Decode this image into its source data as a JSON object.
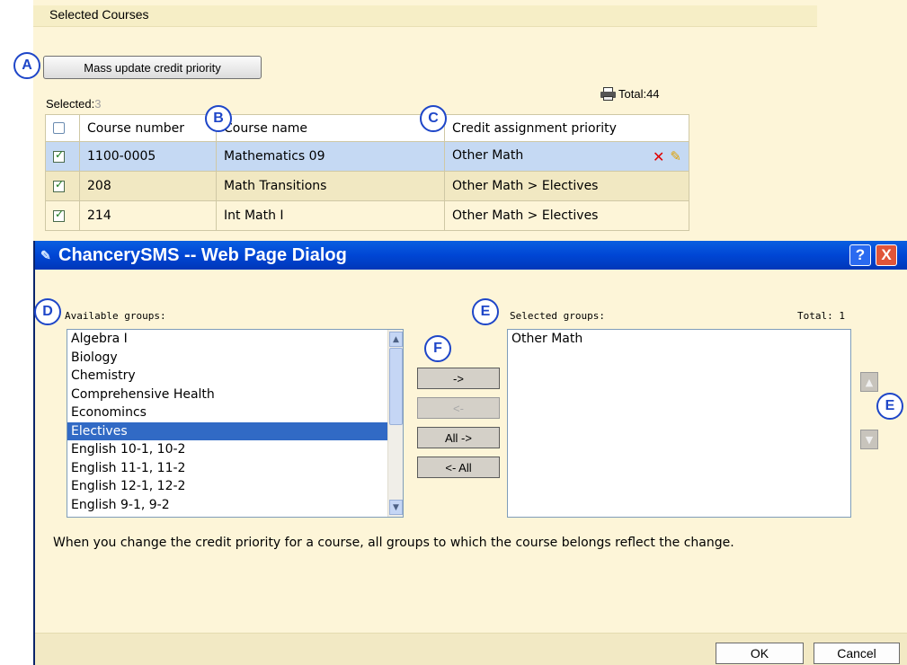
{
  "page": {
    "section_title": "Selected Courses",
    "mass_update_label": "Mass update credit priority",
    "selected_label": "Selected:",
    "selected_count": "3",
    "total_label": "Total:44"
  },
  "table": {
    "headers": [
      "",
      "Course number",
      "Course name",
      "Credit assignment priority"
    ],
    "rows": [
      {
        "checked": true,
        "number": "1100-0005",
        "name": "Mathematics 09",
        "priority": "Other Math"
      },
      {
        "checked": true,
        "number": "208",
        "name": "Math Transitions",
        "priority": "Other Math > Electives"
      },
      {
        "checked": true,
        "number": "214",
        "name": "Int Math I",
        "priority": "Other Math > Electives"
      }
    ]
  },
  "callouts": {
    "a": "A",
    "b": "B",
    "c": "C",
    "d": "D",
    "e1": "E",
    "e2": "E",
    "f": "F"
  },
  "dialog": {
    "title": "ChancerySMS -- Web Page Dialog",
    "help": "?",
    "close": "X",
    "available_label": "Available groups:",
    "selected_label": "Selected groups:",
    "selected_total": "Total: 1",
    "available_groups": [
      "Algebra I",
      "Biology",
      "Chemistry",
      "Comprehensive Health",
      "Economincs",
      "Electives",
      "English 10-1, 10-2",
      "English 11-1, 11-2",
      "English 12-1, 12-2",
      "English 9-1, 9-2"
    ],
    "available_selected": "Electives",
    "selected_groups": [
      "Other Math"
    ],
    "move_right": "->",
    "move_left": "<-",
    "move_all_right": "All ->",
    "move_all_left": "<- All",
    "note": "When you change the credit priority for a course, all groups to which the course belongs reflect the change.",
    "ok": "OK",
    "cancel": "Cancel"
  },
  "icons": {
    "delete": "x-icon",
    "edit": "pencil-icon",
    "print": "printer-icon",
    "up": "arrow-up-icon",
    "down": "arrow-down-icon"
  }
}
